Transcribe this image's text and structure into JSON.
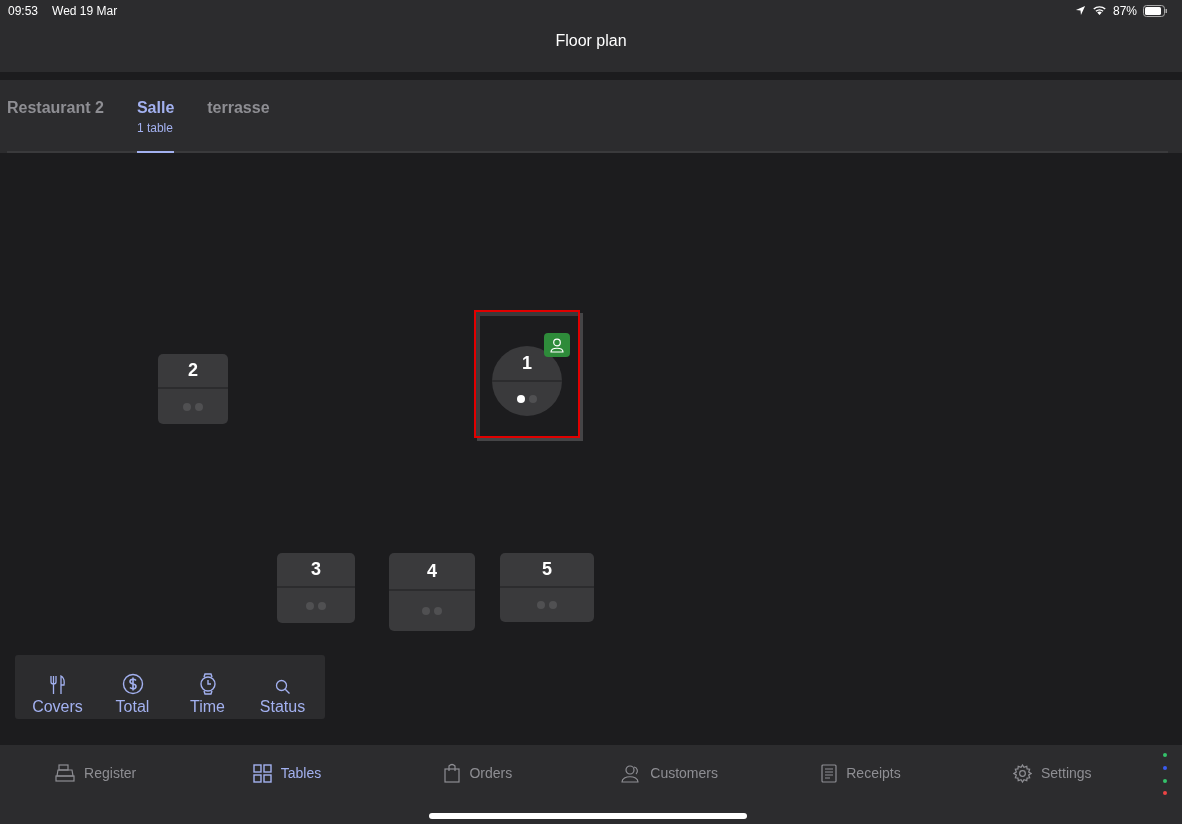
{
  "status_bar": {
    "time": "09:53",
    "date": "Wed 19 Mar",
    "battery": "87%"
  },
  "header": {
    "title": "Floor plan"
  },
  "tabs": [
    {
      "label": "Restaurant 2",
      "selected": false
    },
    {
      "label": "Salle",
      "subtitle": "1 table",
      "selected": true
    },
    {
      "label": "terrasse",
      "selected": false
    }
  ],
  "tables": [
    {
      "number": "2",
      "kind": "square",
      "selected": false,
      "occupied": false,
      "seats": [
        {
          "filled": false
        },
        {
          "filled": false
        }
      ]
    },
    {
      "number": "1",
      "kind": "round",
      "selected": true,
      "occupied": true,
      "seats": [
        {
          "filled": true
        },
        {
          "filled": false
        }
      ]
    },
    {
      "number": "3",
      "kind": "square",
      "selected": false,
      "occupied": false,
      "seats": [
        {
          "filled": false
        },
        {
          "filled": false
        }
      ]
    },
    {
      "number": "4",
      "kind": "square",
      "selected": false,
      "occupied": false,
      "seats": [
        {
          "filled": false
        },
        {
          "filled": false
        }
      ]
    },
    {
      "number": "5",
      "kind": "square",
      "selected": false,
      "occupied": false,
      "seats": [
        {
          "filled": false
        },
        {
          "filled": false
        }
      ]
    }
  ],
  "view_options": [
    {
      "label": "Covers",
      "kind": "covers"
    },
    {
      "label": "Total",
      "kind": "total"
    },
    {
      "label": "Time",
      "kind": "time"
    },
    {
      "label": "Status",
      "kind": "status"
    }
  ],
  "nav": [
    {
      "label": "Register",
      "kind": "register",
      "selected": false
    },
    {
      "label": "Tables",
      "kind": "tables",
      "selected": true
    },
    {
      "label": "Orders",
      "kind": "orders",
      "selected": false
    },
    {
      "label": "Customers",
      "kind": "customers",
      "selected": false
    },
    {
      "label": "Receipts",
      "kind": "receipts",
      "selected": false
    },
    {
      "label": "Settings",
      "kind": "settings",
      "selected": false
    }
  ]
}
